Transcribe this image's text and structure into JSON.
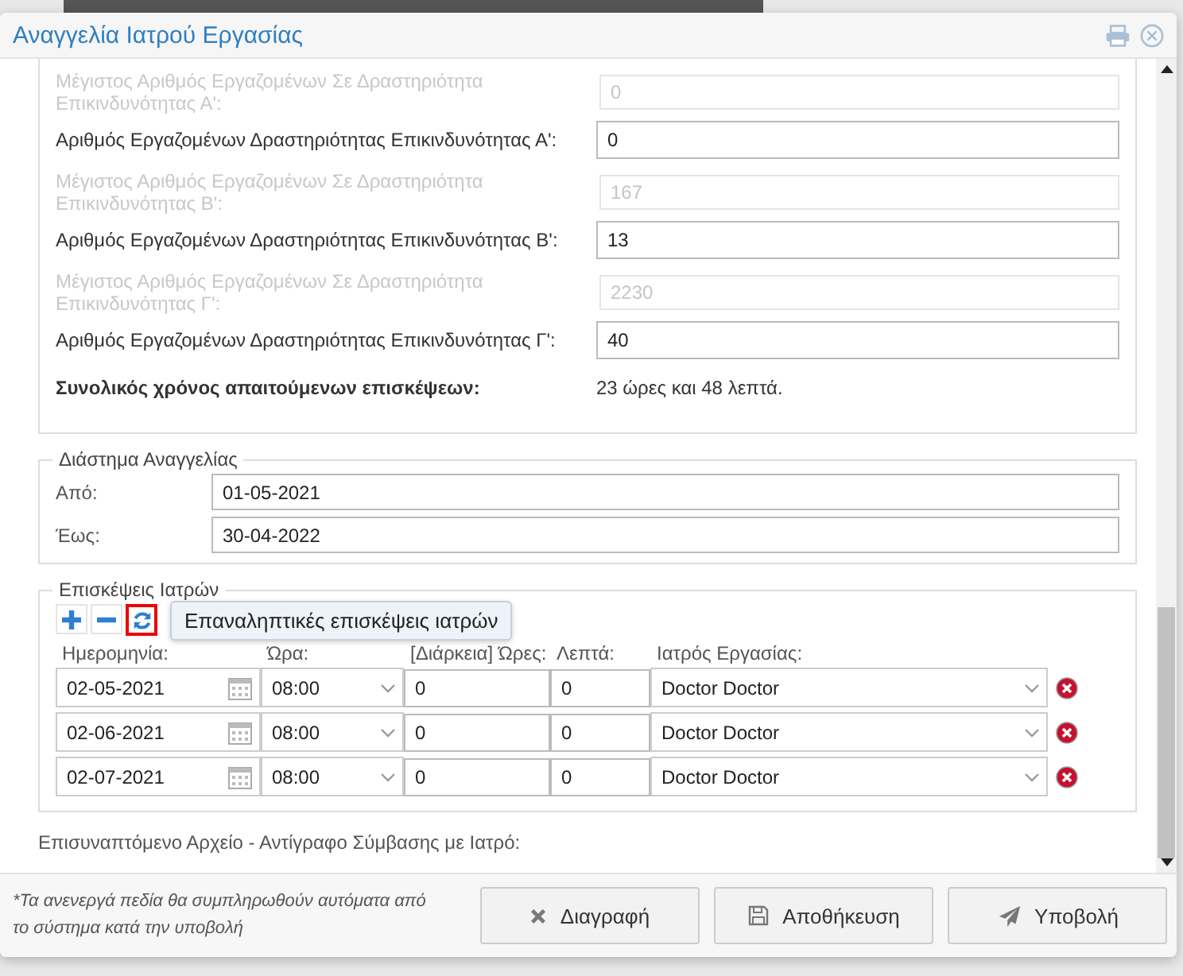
{
  "window": {
    "title": "Αναγγελία Ιατρού Εργασίας"
  },
  "employee_fields": [
    {
      "kind": "readonly",
      "label": "Μέγιστος Αριθμός Εργαζομένων Σε Δραστηριότητα Επικινδυνότητας Α':",
      "value": "0"
    },
    {
      "kind": "input",
      "label": "Αριθμός Εργαζομένων Δραστηριότητας Επικινδυνότητας Α':",
      "value": "0"
    },
    {
      "kind": "readonly",
      "label": "Μέγιστος Αριθμός Εργαζομένων Σε Δραστηριότητα Επικινδυνότητας Β':",
      "value": "167"
    },
    {
      "kind": "input",
      "label": "Αριθμός Εργαζομένων Δραστηριότητας Επικινδυνότητας Β':",
      "value": "13"
    },
    {
      "kind": "readonly",
      "label": "Μέγιστος Αριθμός Εργαζομένων Σε Δραστηριότητα Επικινδυνότητας Γ':",
      "value": "2230"
    },
    {
      "kind": "input",
      "label": "Αριθμός Εργαζομένων Δραστηριότητας Επικινδυνότητας Γ':",
      "value": "40"
    }
  ],
  "total": {
    "label": "Συνολικός χρόνος απαιτούμενων επισκέψεων:",
    "value": "23 ώρες και 48 λεπτά."
  },
  "period": {
    "legend": "Διάστημα Αναγγελίας",
    "rows": [
      {
        "label": "Από:",
        "value": "01-05-2021"
      },
      {
        "label": "Έως:",
        "value": "30-04-2022"
      }
    ]
  },
  "visits": {
    "legend": "Επισκέψεις Ιατρών",
    "tooltip": "Επαναληπτικές επισκέψεις ιατρών",
    "columns": [
      "Ημερομηνία:",
      "Ώρα:",
      "[Διάρκεια] Ώρες:",
      "Λεπτά:",
      "Ιατρός Εργασίας:"
    ],
    "rows": [
      {
        "date": "02-05-2021",
        "time": "08:00",
        "hours": "0",
        "minutes": "0",
        "doctor": "Doctor Doctor"
      },
      {
        "date": "02-06-2021",
        "time": "08:00",
        "hours": "0",
        "minutes": "0",
        "doctor": "Doctor Doctor"
      },
      {
        "date": "02-07-2021",
        "time": "08:00",
        "hours": "0",
        "minutes": "0",
        "doctor": "Doctor Doctor"
      }
    ]
  },
  "attachment_label": "Επισυναπτόμενο Αρχείο - Αντίγραφο Σύμβασης με Ιατρό:",
  "footer": {
    "note": "*Τα ανενεργά πεδία θα συμπληρωθούν αυτόματα από το σύστημα κατά την υποβολή",
    "buttons": [
      {
        "kind": "delete",
        "label": "Διαγραφή"
      },
      {
        "kind": "save",
        "label": "Αποθήκευση"
      },
      {
        "kind": "submit",
        "label": "Υποβολή"
      }
    ]
  }
}
